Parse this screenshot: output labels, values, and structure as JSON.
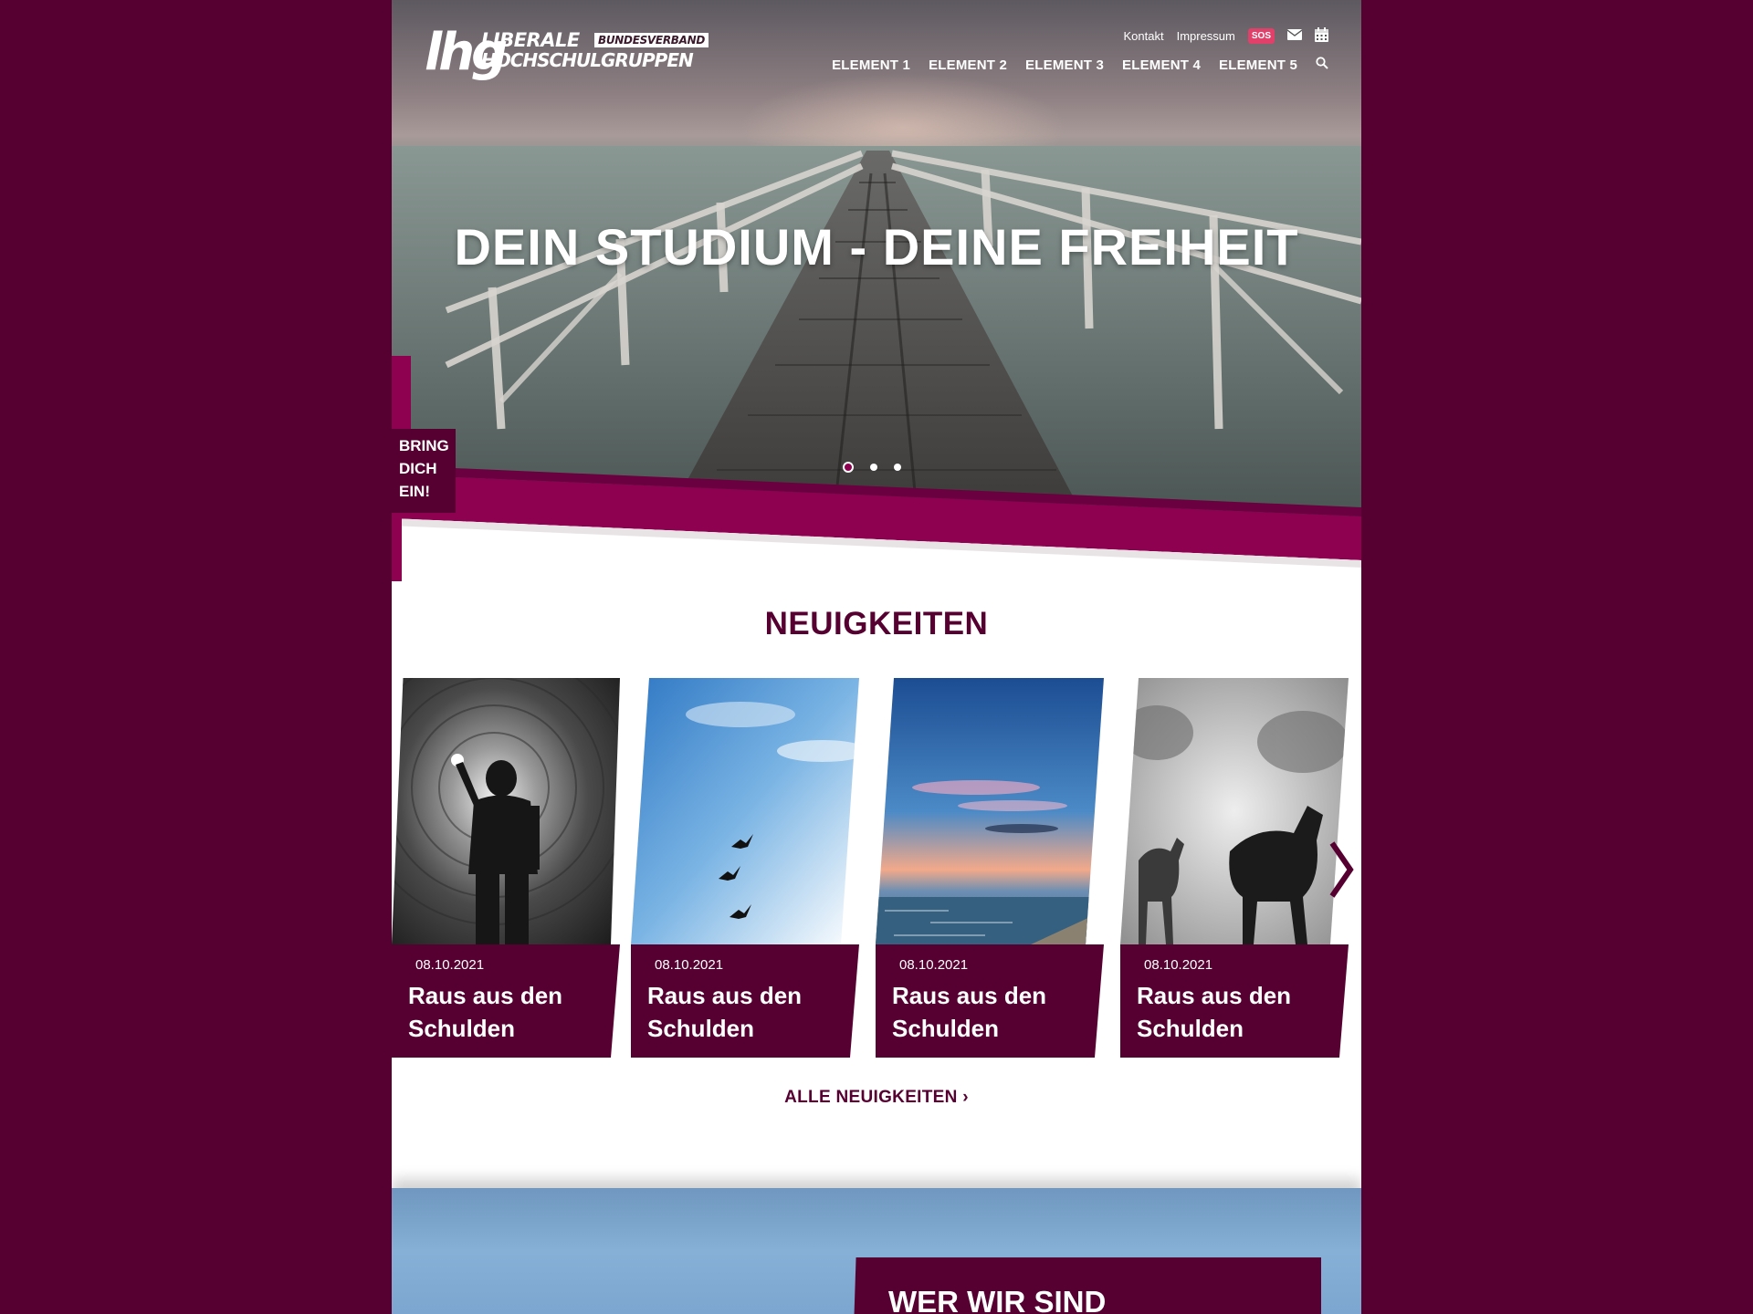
{
  "brand": {
    "logo_mark": "lhg",
    "name_line1": "LIBERALE",
    "name_badge": "BUNDESVERBAND",
    "name_line2": "HOCHSCHULGRUPPEN"
  },
  "topbar": {
    "links": [
      "Kontakt",
      "Impressum"
    ],
    "sos_label": "SOS",
    "icons": [
      "envelope-icon",
      "calendar-icon"
    ]
  },
  "nav": {
    "items": [
      "ELEMENT 1",
      "ELEMENT 2",
      "ELEMENT 3",
      "ELEMENT 4",
      "ELEMENT 5"
    ],
    "search_icon": "search-icon"
  },
  "hero": {
    "title": "DEIN STUDIUM - DEINE FREIHEIT",
    "slides": 3,
    "active_slide": 1
  },
  "cta": {
    "line1": "BRING",
    "line2": "DICH",
    "line3": "EIN!"
  },
  "news": {
    "title": "NEUIGKEITEN",
    "items": [
      {
        "date": "08.10.2021",
        "headline": "Raus aus den Schulden",
        "image": "tunnel"
      },
      {
        "date": "08.10.2021",
        "headline": "Raus aus den Schulden",
        "image": "birds-sky"
      },
      {
        "date": "08.10.2021",
        "headline": "Raus aus den Schulden",
        "image": "sunset-sea"
      },
      {
        "date": "08.10.2021",
        "headline": "Raus aus den Schulden",
        "image": "horses-fog"
      }
    ],
    "all_label": "ALLE NEUIGKEITEN ›"
  },
  "about": {
    "title": "WER WIR SIND"
  },
  "colors": {
    "background": "#560032",
    "accent": "#8e0050",
    "sos": "#e0406a"
  }
}
